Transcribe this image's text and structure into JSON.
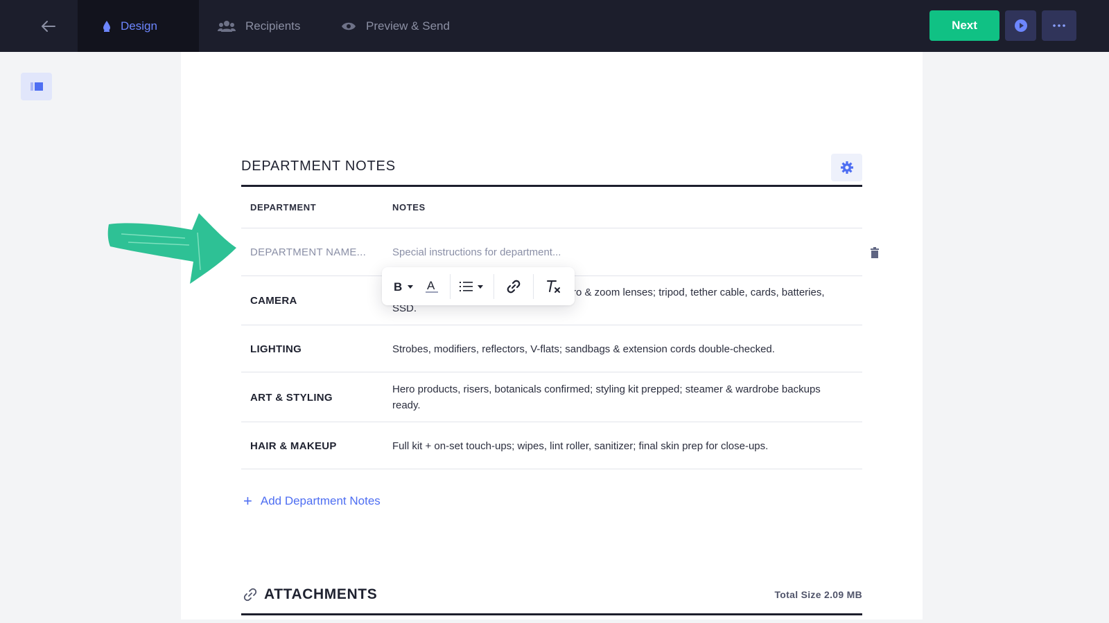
{
  "topbar": {
    "tabs": [
      {
        "label": "Design",
        "icon": "droplet-icon",
        "active": true
      },
      {
        "label": "Recipients",
        "icon": "people-icon",
        "active": false
      },
      {
        "label": "Preview & Send",
        "icon": "eye-icon",
        "active": false
      }
    ],
    "next_label": "Next",
    "colors": {
      "bar": "#1c1e2c",
      "active_tab": "#6d86ff",
      "next": "#10c184"
    }
  },
  "section": {
    "title": "DEPARTMENT NOTES",
    "columns": {
      "department": "DEPARTMENT",
      "notes": "NOTES"
    },
    "new_row": {
      "department_placeholder": "DEPARTMENT NAME...",
      "notes_placeholder": "Special instructions for department..."
    },
    "rows": [
      {
        "department": "CAMERA",
        "notes": "ro & zoom lenses; tripod, tether cable, cards, batteries,",
        "notes_line2": "SSD."
      },
      {
        "department": "LIGHTING",
        "notes": "Strobes, modifiers, reflectors, V-flats; sandbags & extension cords double-checked."
      },
      {
        "department": "ART & STYLING",
        "notes": "Hero products, risers, botanicals confirmed; styling kit prepped; steamer & wardrobe backups ready."
      },
      {
        "department": "HAIR & MAKEUP",
        "notes": "Full kit + on-set touch-ups; wipes, lint roller, sanitizer; final skin prep for close-ups."
      }
    ],
    "add_label": "Add Department Notes"
  },
  "toolbar": {
    "buttons": [
      "bold-icon",
      "text-color-icon",
      "list-icon",
      "link-icon",
      "clear-format-icon"
    ]
  },
  "attachments": {
    "title": "ATTACHMENTS",
    "total_size": "Total Size 2.09 MB"
  }
}
